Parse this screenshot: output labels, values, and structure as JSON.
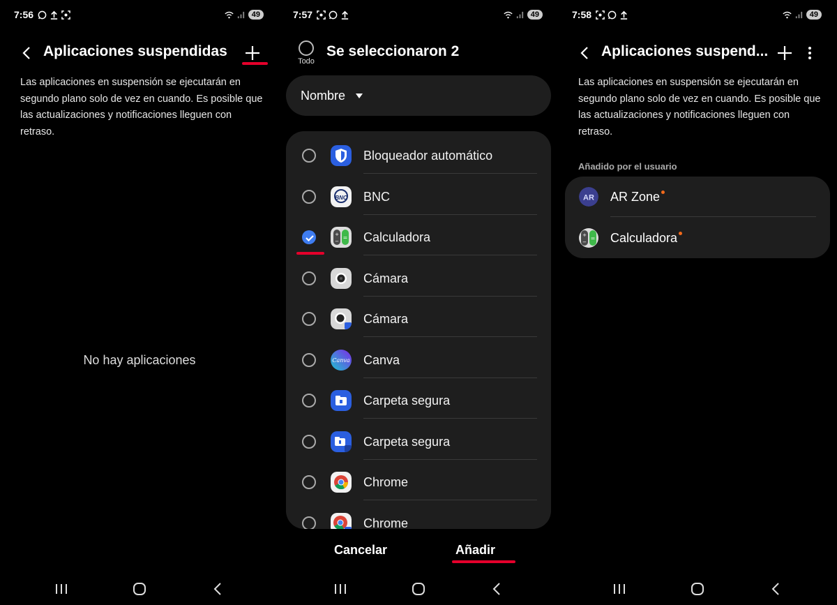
{
  "panel1": {
    "status_time": "7:56",
    "battery": "49",
    "title": "Aplicaciones suspendidas",
    "description": "Las aplicaciones en suspensión se ejecutarán en segundo plano solo de vez en cuando. Es posible que las actualizaciones y notificaciones lleguen con retraso.",
    "empty_text": "No hay aplicaciones"
  },
  "panel2": {
    "status_time": "7:57",
    "battery": "49",
    "select_all_label": "Todo",
    "title": "Se seleccionaron 2",
    "sort_label": "Nombre",
    "apps": [
      {
        "label": "Bloqueador automático",
        "checked": false,
        "icon": "shield-icon"
      },
      {
        "label": "BNC",
        "checked": false,
        "icon": "bnc-icon"
      },
      {
        "label": "Calculadora",
        "checked": true,
        "icon": "calculator-icon"
      },
      {
        "label": "Cámara",
        "checked": false,
        "icon": "camera-icon"
      },
      {
        "label": "Cámara",
        "checked": false,
        "icon": "camera-secure-icon"
      },
      {
        "label": "Canva",
        "checked": false,
        "icon": "canva-icon"
      },
      {
        "label": "Carpeta segura",
        "checked": false,
        "icon": "secure-folder-icon"
      },
      {
        "label": "Carpeta segura",
        "checked": false,
        "icon": "secure-folder-secure-icon"
      },
      {
        "label": "Chrome",
        "checked": false,
        "icon": "chrome-icon"
      },
      {
        "label": "Chrome",
        "checked": false,
        "icon": "chrome-secure-icon"
      }
    ],
    "cancel_label": "Cancelar",
    "add_label": "Añadir"
  },
  "panel3": {
    "status_time": "7:58",
    "battery": "49",
    "title": "Aplicaciones suspend...",
    "description": "Las aplicaciones en suspensión se ejecutarán en segundo plano solo de vez en cuando. Es posible que las actualizaciones y notificaciones lleguen con retraso.",
    "section_label": "Añadido por el usuario",
    "apps": [
      {
        "label": "AR Zone",
        "icon": "ar-zone-icon",
        "icon_text": "AR"
      },
      {
        "label": "Calculadora",
        "icon": "calculator-icon"
      }
    ]
  },
  "colors": {
    "background": "#000000",
    "card": "#1e1e1e",
    "highlight_underline": "#e4002b",
    "checkbox_accent": "#3e7cf0",
    "new_dot": "#f26a1b"
  }
}
